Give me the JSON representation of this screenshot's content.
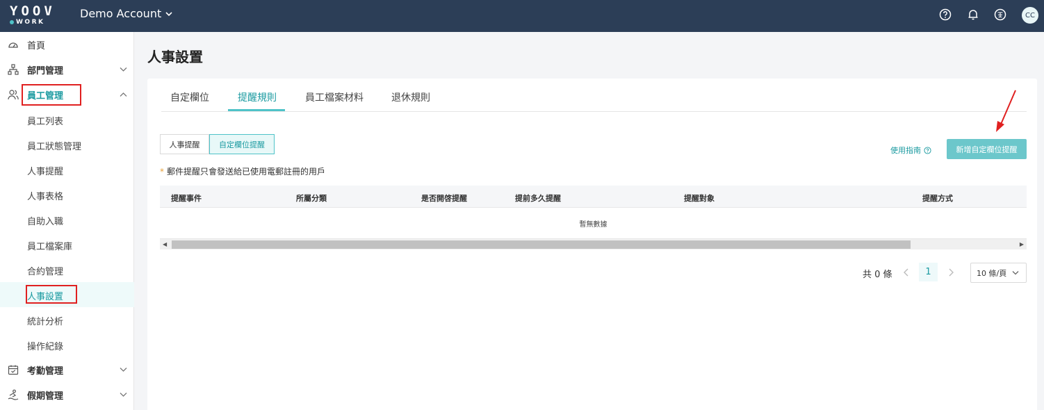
{
  "header": {
    "logo_top": "YOOV",
    "logo_bottom": "WORK",
    "account": "Demo Account",
    "avatar": "CC"
  },
  "sidebar": {
    "items": [
      {
        "label": "首頁",
        "icon": "dashboard-icon"
      },
      {
        "label": "部門管理",
        "icon": "org-chart-icon"
      },
      {
        "label": "員工管理",
        "icon": "users-icon"
      },
      {
        "label": "考勤管理",
        "icon": "calendar-check-icon"
      },
      {
        "label": "假期管理",
        "icon": "beach-icon"
      }
    ],
    "sub_items": [
      "員工列表",
      "員工狀態管理",
      "人事提醒",
      "人事表格",
      "自助入職",
      "員工檔案庫",
      "合約管理",
      "人事設置",
      "統計分析",
      "操作紀錄"
    ]
  },
  "main": {
    "title": "人事設置",
    "tabs": [
      "自定欄位",
      "提醒規則",
      "員工檔案材料",
      "退休規則"
    ],
    "segments": [
      "人事提醒",
      "自定欄位提醒"
    ],
    "guide": "使用指南",
    "add_button": "新增自定欄位提醒",
    "note_star": "*",
    "note": "郵件提醒只會發送給已使用電郵註冊的用戶",
    "table": {
      "columns": [
        "提醒事件",
        "所屬分類",
        "是否開啓提醒",
        "提前多久提醒",
        "提醒對象",
        "提醒方式"
      ],
      "empty": "暫無數據"
    },
    "pagination": {
      "total": "共 0 條",
      "page": "1",
      "page_size": "10 條/頁"
    }
  },
  "colors": {
    "header_bg": "#2c3e57",
    "accent": "#4fc3c8",
    "highlight_box": "#e02020"
  }
}
